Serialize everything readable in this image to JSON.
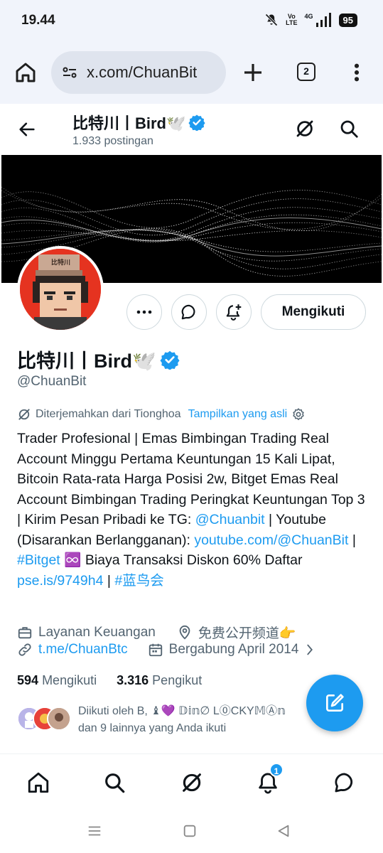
{
  "status_bar": {
    "time": "19.44",
    "network": "4G",
    "volte_line1": "Vo",
    "volte_line2": "LTE",
    "battery": "95"
  },
  "browser": {
    "url": "x.com/ChuanBit",
    "tab_count": "2"
  },
  "header": {
    "name": "比特川丨Bird🕊️",
    "posts": "1.933 postingan"
  },
  "profile": {
    "avatar_text": "比特川",
    "name": "比特川丨Bird🕊️",
    "handle": "@ChuanBit",
    "follow_label": "Mengikuti",
    "translated_label": "Diterjemahkan dari Tionghoa",
    "show_original": "Tampilkan yang asli",
    "bio_part1": "Trader Profesional | Emas Bimbingan Trading Real Account Minggu Pertama Keuntungan 15 Kali Lipat, Bitcoin Rata-rata Harga Posisi 2w, Bitget Emas Real Account Bimbingan Trading Peringkat Keuntungan Top 3 | Kirim Pesan Pribadi ke TG: ",
    "bio_link1": "@Chuanbit",
    "bio_part2": " | Youtube (Disarankan Berlangganan): ",
    "bio_link2": "youtube.com/@ChuanBit",
    "bio_part3": " | ",
    "bio_link3": "#Bitget",
    "bio_emoji": "♾️",
    "bio_part4": " Biaya Transaksi Diskon 60% Daftar ",
    "bio_link4": "pse.is/9749h4",
    "bio_part5": " | ",
    "bio_link5": "#蓝鸟会",
    "category": "Layanan Keuangan",
    "location": "免费公开频道👉",
    "website": "t.me/ChuanBtc",
    "joined": "Bergabung April 2014",
    "following_count": "594",
    "following_label": "Mengikuti",
    "followers_count": "3.316",
    "followers_label": "Pengikut",
    "followed_by": "Diikuti oleh B, ♝💜 𝔻𝕚𝕟∅ L⓪CKY𝕄Ⓐ𝕟",
    "followed_by_more": "dan 9 lainnya yang Anda ikuti"
  },
  "bottom_nav": {
    "notifications_badge": "1"
  },
  "colors": {
    "accent": "#1d9bf0",
    "text": "#0f1419",
    "secondary": "#536471",
    "avatar_bg": "#e53320"
  }
}
